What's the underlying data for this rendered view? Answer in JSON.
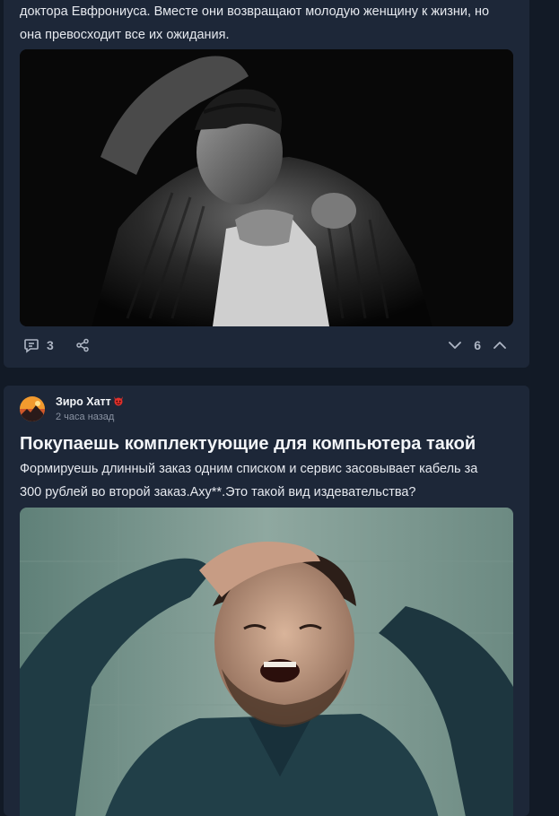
{
  "posts": [
    {
      "text_lines": [
        "доктора Евфрониуса. Вместе они возвращают молодую женщину к жизни, но",
        "она превосходит все их ожидания."
      ],
      "image_alt": "Black and white photo of a man in a striped shirt with a stitched wound on his forehead, pulling open his collar",
      "comments_count": "3",
      "rating": "6",
      "icons": {
        "comments": "comment-bubble-icon",
        "share": "share-icon",
        "vote_down": "chevron-down-icon",
        "vote_up": "chevron-up-icon"
      }
    },
    {
      "author": {
        "name": "Зиро Хатт",
        "badge": "red-devil-emoji",
        "time": "2 часа назад"
      },
      "title": "Покупаешь комплектующие для компьютера такой",
      "text_lines": [
        "Формируешь длинный  заказ одним списком и  сервис засовывает кабель за",
        "300 рублей во второй заказ.Аху**.Это такой вид издевательства?"
      ],
      "image_alt": "Man in a dark shirt laughing hysterically with hand on his head in a green tiled bathroom"
    }
  ],
  "colors": {
    "page_bg": "#121a26",
    "card_bg": "#1d2738",
    "text": "#e6e9ef",
    "muted": "#8a93a3",
    "icon": "#aeb6c4"
  }
}
